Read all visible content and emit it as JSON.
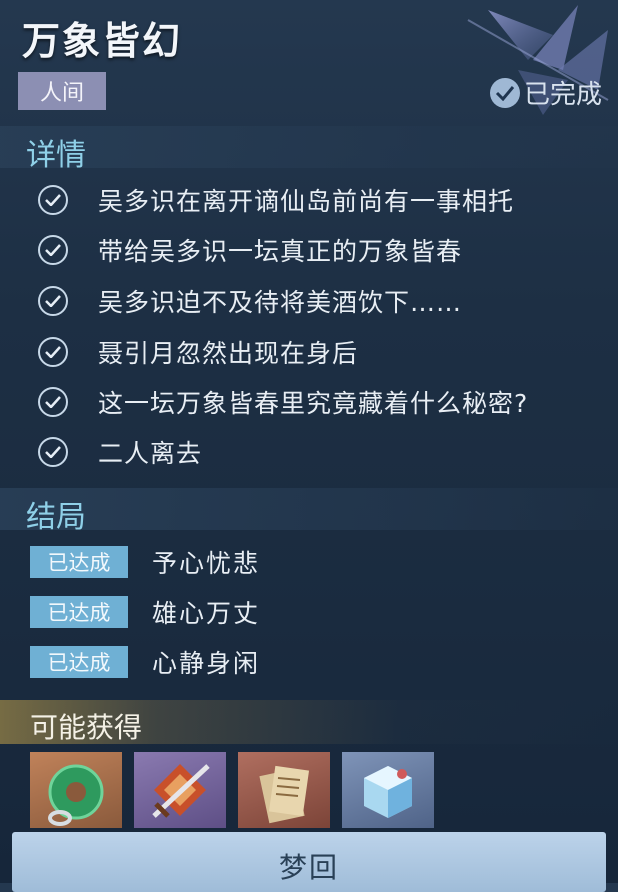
{
  "header": {
    "title": "万象皆幻",
    "tag": "人间",
    "status": "已完成"
  },
  "details": {
    "heading": "详情",
    "items": [
      "吴多识在离开谪仙岛前尚有一事相托",
      "带给吴多识一坛真正的万象皆春",
      "吴多识迫不及待将美酒饮下……",
      "聂引月忽然出现在身后",
      "这一坛万象皆春里究竟藏着什么秘密?",
      "二人离去"
    ]
  },
  "endings": {
    "heading": "结局",
    "items": [
      {
        "badge": "已达成",
        "label": "予心忧悲"
      },
      {
        "badge": "已达成",
        "label": "雄心万丈"
      },
      {
        "badge": "已达成",
        "label": "心静身闲"
      }
    ]
  },
  "rewards": {
    "heading": "可能获得",
    "items": [
      {
        "icon": "jade-pendant-icon"
      },
      {
        "icon": "sword-emblem-icon"
      },
      {
        "icon": "letter-scroll-icon"
      },
      {
        "icon": "ice-cube-icon"
      }
    ]
  },
  "action": {
    "label": "梦回"
  },
  "colors": {
    "accent": "#8fd0e8",
    "badge": "#6fb0d4",
    "tag": "#8c8fb3"
  }
}
